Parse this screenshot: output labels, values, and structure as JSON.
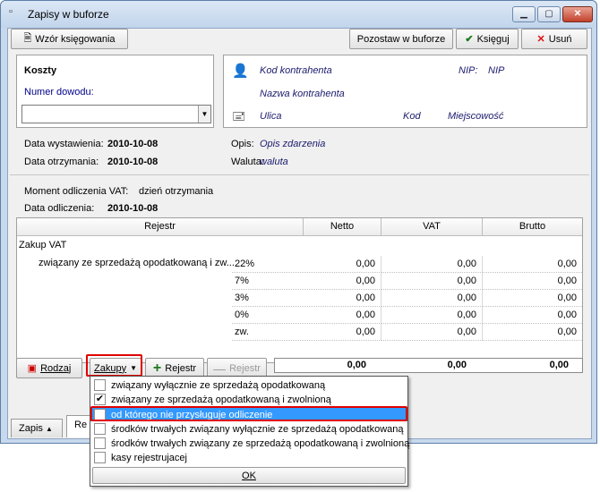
{
  "window": {
    "title": "Zapisy w buforze",
    "icon": "document-icon"
  },
  "toolbar": {
    "pattern_label": "Wzór księgowania",
    "leave_label": "Pozostaw w buforze",
    "book_label": "Księguj",
    "delete_label": "Usuń"
  },
  "costs": {
    "heading": "Koszty",
    "doc_number_label": "Numer dowodu:",
    "doc_number_value": ""
  },
  "contractor": {
    "code": "Kod kontrahenta",
    "nip_label": "NIP:",
    "nip_value": "NIP",
    "name": "Nazwa kontrahenta",
    "street": "Ulica",
    "postcode": "Kod",
    "city": "Miejscowość"
  },
  "dates": {
    "issue_label": "Data wystawienia:",
    "issue_value": "2010-10-08",
    "receipt_label": "Data otrzymania:",
    "receipt_value": "2010-10-08"
  },
  "desc": {
    "label": "Opis:",
    "value": "Opis zdarzenia"
  },
  "currency": {
    "label": "Waluta:",
    "value": "waluta"
  },
  "vat": {
    "moment_label": "Moment odliczenia VAT:",
    "moment_value": "dzień otrzymania",
    "date_label": "Data odliczenia:",
    "date_value": "2010-10-08"
  },
  "grid": {
    "headers": [
      "Rejestr",
      "Netto",
      "VAT",
      "Brutto"
    ],
    "group": "Zakup VAT",
    "item": "związany ze sprzedażą opodatkowaną i zw...",
    "rows": [
      {
        "rate": "22%",
        "netto": "0,00",
        "vat": "0,00",
        "brutto": "0,00"
      },
      {
        "rate": "7%",
        "netto": "0,00",
        "vat": "0,00",
        "brutto": "0,00"
      },
      {
        "rate": "3%",
        "netto": "0,00",
        "vat": "0,00",
        "brutto": "0,00"
      },
      {
        "rate": "0%",
        "netto": "0,00",
        "vat": "0,00",
        "brutto": "0,00"
      },
      {
        "rate": "zw.",
        "netto": "0,00",
        "vat": "0,00",
        "brutto": "0,00"
      }
    ]
  },
  "bottom": {
    "kind_label": "Rodzaj",
    "purchases_label": "Zakupy",
    "add_register_label": "Rejestr",
    "remove_register_label": "Rejestr",
    "totals": {
      "netto": "0,00",
      "vat": "0,00",
      "brutto": "0,00"
    }
  },
  "tabs": {
    "zapis_label": "Zapis",
    "second_partial": "Re"
  },
  "popup": {
    "options": [
      {
        "label": "związany wyłącznie ze sprzedażą opodatkowaną",
        "checked": false
      },
      {
        "label": "związany ze sprzedażą opodatkowaną i zwolnioną",
        "checked": true
      },
      {
        "label": "od którego nie przysługuje odliczenie",
        "checked": false
      },
      {
        "label": "środków trwałych związany wyłącznie ze sprzedażą opodatkowaną",
        "checked": false
      },
      {
        "label": "środków trwałych związany ze sprzedażą opodatkowaną i zwolnioną",
        "checked": false
      },
      {
        "label": "kasy rejestrujacej",
        "checked": false
      }
    ],
    "ok_label": "OK"
  },
  "colors": {
    "highlight": "#3399ff",
    "annotation": "#e00000"
  }
}
